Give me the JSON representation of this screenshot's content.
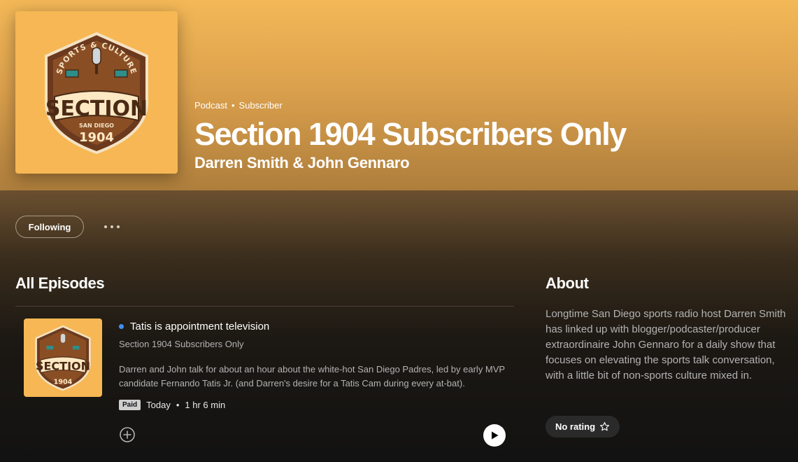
{
  "podcast": {
    "kind": "Podcast",
    "tier": "Subscriber",
    "title": "Section 1904 Subscribers Only",
    "author": "Darren Smith & John Gennaro",
    "cover_art": {
      "arc_text": "SPORTS & CULTURE",
      "word": "SECTION",
      "city": "SAN DIEGO",
      "number": "1904"
    }
  },
  "actions": {
    "following_label": "Following",
    "more_icon": "more-horizontal-icon"
  },
  "episodes_section": {
    "heading": "All Episodes",
    "episodes": [
      {
        "title": "Tatis is appointment television",
        "show": "Section 1904 Subscribers Only",
        "description": "Darren and John talk for about an hour about the white-hot San Diego Padres, led by early MVP candidate Fernando Tatis Jr. (and Darren's desire for a Tatis Cam during every at-bat).",
        "badge": "Paid",
        "date": "Today",
        "duration": "1 hr 6 min",
        "status_color": "#3d91f4"
      }
    ]
  },
  "about": {
    "heading": "About",
    "text": "Longtime San Diego sports radio host Darren Smith has linked up with blogger/podcaster/producer extraordinaire John Gennaro for a daily show that focuses on elevating the sports talk conversation, with a little bit of non-sports culture mixed in.",
    "rating_label": "No rating"
  },
  "colors": {
    "hero_top": "#f3b857",
    "cover_background": "#f6b754",
    "new_episode_dot": "#3d91f4"
  }
}
